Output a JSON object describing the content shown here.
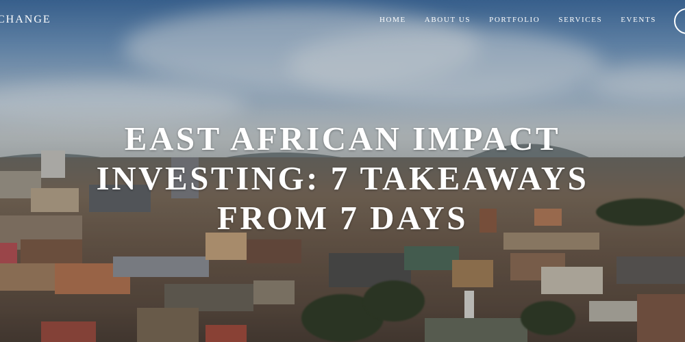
{
  "header": {
    "logo_text": "CHANGE",
    "nav": [
      {
        "label": "HOME"
      },
      {
        "label": "ABOUT US"
      },
      {
        "label": "PORTFOLIO"
      },
      {
        "label": "SERVICES"
      },
      {
        "label": "EVENTS"
      }
    ]
  },
  "hero": {
    "title": "EAST AFRICAN IMPACT INVESTING: 7 TAKEAWAYS FROM 7 DAYS",
    "background": "city-skyline-photo"
  },
  "colors": {
    "text": "#ffffff",
    "sky": "#6d95bf",
    "city": "#6a5747"
  }
}
